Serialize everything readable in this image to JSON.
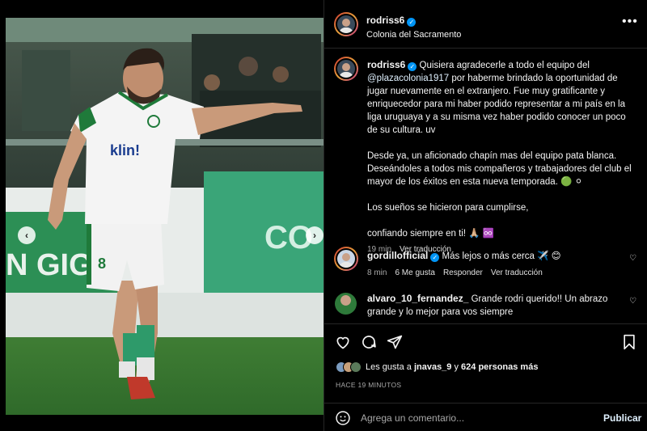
{
  "post": {
    "author": "rodriss6",
    "location": "Colonia del Sacramento",
    "more_icon": "more-horizontal-icon",
    "photo_sponsor": "klin!",
    "photo_banner_left": "N GIGA",
    "photo_banner_right": "CO",
    "photo_shorts_number": "8",
    "carousel": {
      "total_dots": 10,
      "active_dot": 1
    }
  },
  "caption": {
    "author": "rodriss6",
    "paragraph1_text": " Quisiera agradecerle a todo el equipo del ",
    "paragraph1_mention": "@plazacolonia1917",
    "paragraph1_rest": " por haberme brindado la oportunidad de jugar nuevamente en el extranjero. Fue muy gratificante y enriquecedor para mi haber podido representar a mi país en la liga uruguaya y a su misma vez haber podido conocer un poco de su cultura. uv",
    "paragraph2": "Desde ya, un aficionado chapín mas del equipo pata blanca. Deseándoles a todos mis compañeros y trabajadores del club el mayor de los éxitos en esta nueva temporada. 🟢 ⚪",
    "paragraph3": "Los sueños se hicieron para cumplirse,",
    "paragraph4": "confiando siempre en ti! 🙏🏼 ♾️",
    "time": "19 min",
    "translate": "Ver traducción"
  },
  "comments": [
    {
      "user": "gordillofficial",
      "verified": true,
      "text": " Más lejos o más cerca ✈️ 😊",
      "time": "8 min",
      "likes": "6 Me gusta",
      "reply": "Responder",
      "translate": "Ver traducción"
    },
    {
      "user": "alvaro_10_fernandez_",
      "verified": false,
      "text": " Grande rodri querido!! Un abrazo grande y lo mejor para vos siempre"
    }
  ],
  "actions": {
    "likes_prefix": "Les gusta a ",
    "likes_user": "jnavas_9",
    "likes_middle": " y ",
    "likes_count": "624 personas más",
    "timestamp": "HACE 19 MINUTOS",
    "comment_placeholder": "Agrega un comentario...",
    "publish_label": "Publicar"
  },
  "colors": {
    "accent_blue": "#0095f6",
    "background": "#000000",
    "muted_text": "#a8a8a8",
    "jersey_green": "#1f7a3a"
  }
}
